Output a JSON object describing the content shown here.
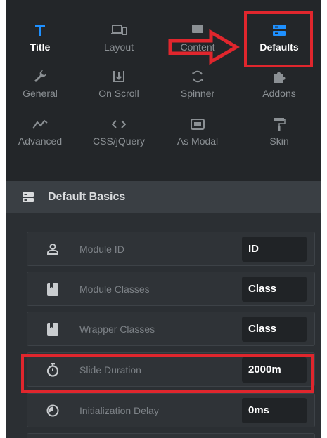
{
  "tabs": [
    {
      "label": "Title",
      "icon": "title-t-icon",
      "active": true
    },
    {
      "label": "Layout",
      "icon": "layout-icon"
    },
    {
      "label": "Content",
      "icon": "content-icon"
    },
    {
      "label": "Defaults",
      "icon": "defaults-icon",
      "active": true
    },
    {
      "label": "General",
      "icon": "wrench-icon"
    },
    {
      "label": "On Scroll",
      "icon": "on-scroll-icon"
    },
    {
      "label": "Spinner",
      "icon": "spinner-icon"
    },
    {
      "label": "Addons",
      "icon": "puzzle-icon"
    },
    {
      "label": "Advanced",
      "icon": "advanced-icon"
    },
    {
      "label": "CSS/jQuery",
      "icon": "code-icon"
    },
    {
      "label": "As Modal",
      "icon": "modal-icon"
    },
    {
      "label": "Skin",
      "icon": "paint-roller-icon"
    }
  ],
  "section": {
    "title": "Default Basics",
    "icon": "defaults-section-icon"
  },
  "fields": [
    {
      "label": "Module ID",
      "value": "ID",
      "icon": "user-icon"
    },
    {
      "label": "Module Classes",
      "value": "Class",
      "icon": "bookmark-icon"
    },
    {
      "label": "Wrapper Classes",
      "value": "Class",
      "icon": "bookmark-icon"
    },
    {
      "label": "Slide Duration",
      "value": "2000m",
      "icon": "stopwatch-icon"
    },
    {
      "label": "Initialization Delay",
      "value": "0ms",
      "icon": "delay-icon"
    }
  ],
  "colors": {
    "accent": "#1e90ff",
    "highlight": "#e0262d",
    "panel": "#2b2f33"
  }
}
